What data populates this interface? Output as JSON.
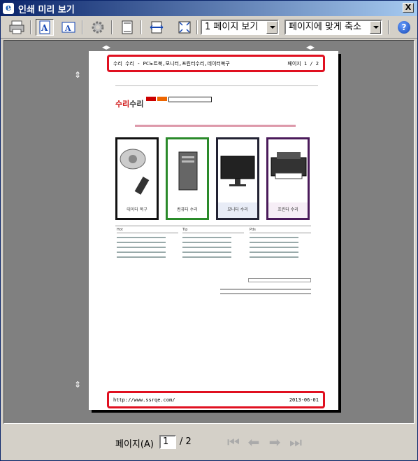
{
  "window": {
    "title": "인쇄 미리 보기",
    "close_label": "X"
  },
  "toolbar": {
    "view_mode": "1 페이지 보기",
    "scale_mode": "페이지에 맞게 축소",
    "help_label": "?",
    "icons": [
      "print-icon",
      "portrait-icon",
      "landscape-icon",
      "page-setup-icon",
      "toggle-header-footer-icon",
      "full-width-icon",
      "full-page-icon",
      "help-icon"
    ]
  },
  "page": {
    "header_left": "수리 수리 - PC노트북,모니터,프린터수리,데이터복구",
    "header_right": "페이지 1 / 2",
    "footer_left": "http://www.ssrqe.com/",
    "footer_right": "2013-06-01"
  },
  "site": {
    "logo_red": "수리",
    "logo_dark": "수리",
    "cards": [
      "데이터 복구",
      "컴퓨터 수리",
      "모니터 수리",
      "프린터 수리"
    ],
    "tips_headers": [
      "Hot",
      "Tip",
      "Pds"
    ]
  },
  "statusbar": {
    "page_label": "페이지(A)",
    "page_value": "1",
    "page_total": "/ 2"
  }
}
